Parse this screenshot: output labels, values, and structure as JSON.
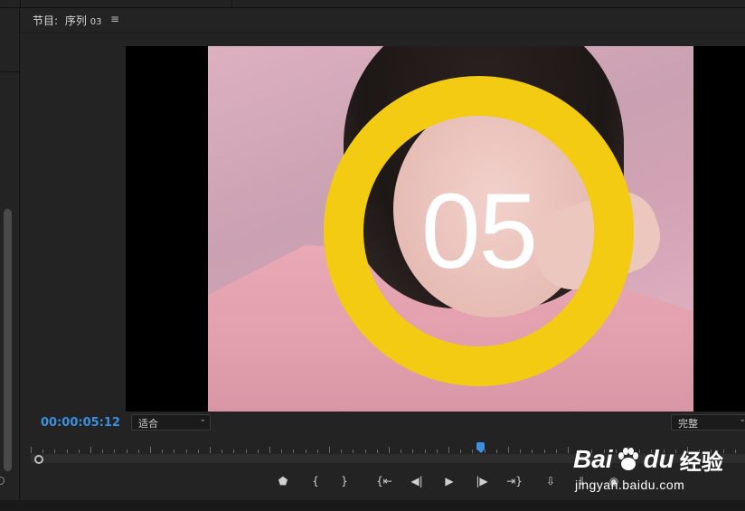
{
  "program_monitor": {
    "title_prefix": "节目:",
    "sequence_name": "序列",
    "sequence_number": "03",
    "menu_icon": "hamburger-menu-icon"
  },
  "video_overlay": {
    "countdown_value": "05",
    "ring_color": "#f2cb12"
  },
  "footer": {
    "timecode": "00:00:05:12",
    "fit_select": {
      "value": "适合",
      "chevron": "⌄"
    },
    "quality_select": {
      "value": "完整",
      "chevron": "⌄"
    }
  },
  "transport_controls": [
    {
      "name": "add-marker-icon",
      "glyph": "⬟"
    },
    {
      "name": "mark-in-icon",
      "glyph": "{"
    },
    {
      "name": "mark-out-icon",
      "glyph": "}"
    },
    {
      "name": "go-to-in-icon",
      "glyph": "{⇤"
    },
    {
      "name": "step-back-icon",
      "glyph": "◀|"
    },
    {
      "name": "play-icon",
      "glyph": "▶"
    },
    {
      "name": "step-forward-icon",
      "glyph": "|▶"
    },
    {
      "name": "go-to-out-icon",
      "glyph": "⇥}"
    },
    {
      "name": "insert-icon",
      "glyph": "⇩"
    },
    {
      "name": "overwrite-icon",
      "glyph": "⇓"
    },
    {
      "name": "export-frame-icon",
      "glyph": "◉"
    }
  ],
  "watermark": {
    "logo_bai": "Bai",
    "logo_du": "du",
    "logo_jingyan": "经验",
    "url": "jingyan.baidu.com"
  },
  "colors": {
    "timecode": "#3a8fde",
    "panel_bg": "#232323",
    "app_bg": "#1d1d1d"
  }
}
